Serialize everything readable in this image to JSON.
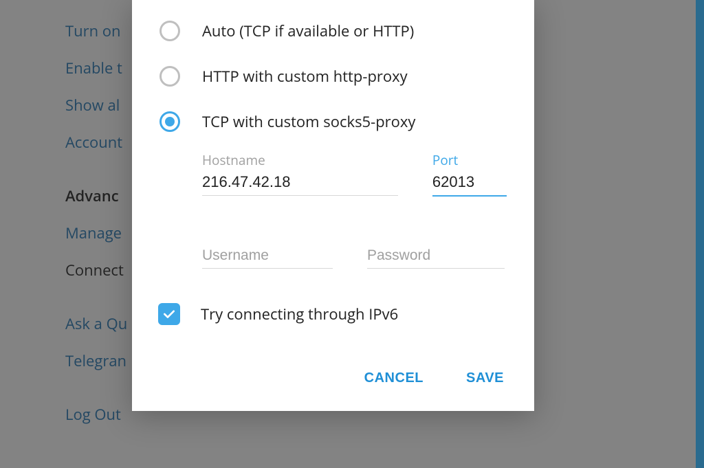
{
  "background": {
    "links": {
      "turn_on": "Turn on",
      "enable": "Enable t",
      "show_all": "Show al",
      "account": "Account",
      "manage": "Manage",
      "ask_q": "Ask a Qu",
      "telegram": "Telegran",
      "log_out": "Log Out"
    },
    "heading_advanced": "Advanc",
    "connect": "Connect"
  },
  "dialog": {
    "radios": {
      "auto": "Auto (TCP if available or HTTP)",
      "http": "HTTP with custom http-proxy",
      "tcp": "TCP with custom socks5-proxy"
    },
    "labels": {
      "hostname": "Hostname",
      "port": "Port",
      "username": "Username",
      "password": "Password"
    },
    "values": {
      "hostname": "216.47.42.18",
      "port": "62013",
      "username": "",
      "password": ""
    },
    "ipv6_label": "Try connecting through IPv6",
    "buttons": {
      "cancel": "CANCEL",
      "save": "SAVE"
    }
  }
}
